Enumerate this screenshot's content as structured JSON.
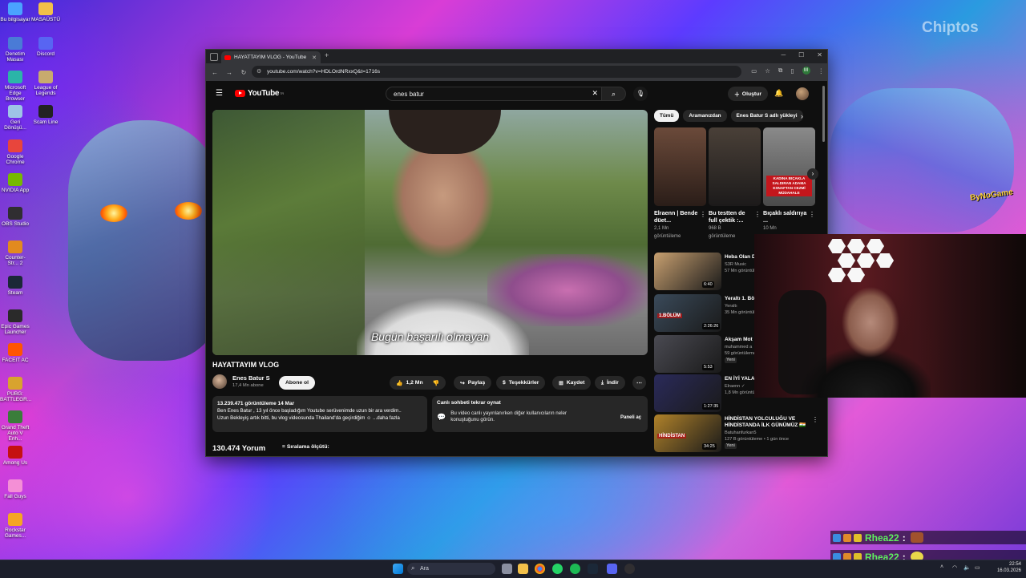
{
  "desktop": {
    "watermark": "Chiptos",
    "bynogame": "ByNoGame",
    "icons": [
      {
        "label": "Bu bilgisayar",
        "icon": "computer-icon",
        "color": "#4aa3ff"
      },
      {
        "label": "MASAÜSTÜ",
        "icon": "folder-icon",
        "color": "#f2c04a"
      },
      {
        "label": "Denetim Masası",
        "icon": "control-panel-icon",
        "color": "#4a7bd6"
      },
      {
        "label": "Discord",
        "icon": "discord-icon",
        "color": "#5865f2"
      },
      {
        "label": "Microsoft Edge Browser",
        "icon": "edge-icon",
        "color": "#2bb5a8"
      },
      {
        "label": "League of Legends",
        "icon": "lol-icon",
        "color": "#c8aa6e"
      },
      {
        "label": "Geri Dönüşü...",
        "icon": "recycle-bin-icon",
        "color": "#9ec4e6"
      },
      {
        "label": "Scam Line",
        "icon": "game-icon",
        "color": "#222222"
      },
      {
        "label": "Google Chrome",
        "icon": "chrome-icon",
        "color": "#e8453c"
      },
      {
        "label": "NVIDIA App",
        "icon": "nvidia-icon",
        "color": "#76b900"
      },
      {
        "label": "OBS Studio",
        "icon": "obs-icon",
        "color": "#302e31"
      },
      {
        "label": "Counter-Str... 2",
        "icon": "cs2-icon",
        "color": "#e28a1e"
      },
      {
        "label": "Steam",
        "icon": "steam-icon",
        "color": "#1b2838"
      },
      {
        "label": "Epic Games Launcher",
        "icon": "epic-icon",
        "color": "#2a2a2a"
      },
      {
        "label": "FACEIT AC",
        "icon": "faceit-icon",
        "color": "#ff5500"
      },
      {
        "label": "PUBG: BATTLEGR...",
        "icon": "pubg-icon",
        "color": "#d8a32e"
      },
      {
        "label": "Grand Theft Auto V Enh...",
        "icon": "gta-icon",
        "color": "#3a7d3a"
      },
      {
        "label": "Among Us",
        "icon": "among-us-icon",
        "color": "#c51111"
      },
      {
        "label": "Fall Guys",
        "icon": "fall-guys-icon",
        "color": "#f48fd6"
      },
      {
        "label": "Rockstar Games...",
        "icon": "rockstar-icon",
        "color": "#f5a623"
      }
    ]
  },
  "browser": {
    "tab_title": "HAYATTAYIM VLOG - YouTube",
    "url": "youtube.com/watch?v=HDLOrdNRxxQ&t=1716s",
    "profile_letter": "M"
  },
  "youtube": {
    "logo": "YouTube",
    "logo_region": "TR",
    "search_value": "enes batur",
    "create_label": "Oluştur",
    "subtitle": "Bugün başarılı olmayan",
    "video_title": "HAYATTAYIM VLOG",
    "channel_name": "Enes Batur S",
    "channel_subs": "17,4 Mn abone",
    "subscribe_label": "Abone ol",
    "like_count": "1,2 Mn",
    "share_label": "Paylaş",
    "thanks_label": "Teşekkürler",
    "save_label": "Kaydet",
    "download_label": "İndir",
    "desc_meta": "13.239.471 görüntüleme  14 Mar",
    "desc_line1": "Ben Enes Batur , 13 yıl önce başladığım Youtube serüvenimde uzun bir ara verdim..",
    "desc_line2": "Uzun Bekleyiş artık bitti, bu vlog videosunda Thailand'da geçirdiğim ☺ ...daha fazla",
    "chat_title": "Canlı sohbeti tekrar oynat",
    "chat_text": "Bu video canlı yayınlanırken diğer kullanıcıların neler konuştuğunu görün.",
    "chat_button": "Paneli aç",
    "comment_count": "130.474 Yorum",
    "sort_label": "Sıralama ölçütü:",
    "chips": [
      "Tümü",
      "Aramanızdan",
      "Enes Batur S adlı yükleyi"
    ],
    "shorts": [
      {
        "title": "Elraenn | Bende düet...",
        "meta1": "2,1 Mn",
        "meta2": "görüntüleme",
        "color": "#5a3a2a"
      },
      {
        "title": "Bu testten de full çektik :...",
        "meta1": "968 B",
        "meta2": "görüntüleme",
        "color": "#3a3a3a"
      },
      {
        "title": "Bıçaklı saldırıya ...",
        "meta1": "10 Mn",
        "meta2": "",
        "caption": "KADINA BIÇAKLA SALDIRAN ADAMA ESNAFTAN CEZMİ MÜDAHALE",
        "color": "#7a7a7a"
      }
    ],
    "videos": [
      {
        "title": "Heba Olan D",
        "meta1": "S3R Music",
        "meta2": "57 Mn görüntülem",
        "duration": "6:40",
        "color": "#c8a070"
      },
      {
        "title": "Yeraltı 1. Bö",
        "meta1": "Yeraltı",
        "meta2": "35 Mn görüntüle",
        "duration": "2:26:26",
        "overlay": "1.BÖLÜM",
        "color": "#3a4a5a"
      },
      {
        "title": "Akşam Mot",
        "meta1": "muhammed a",
        "meta2": "59 görüntüleme",
        "badge": "Yeni",
        "duration": "5:53",
        "color": "#4a4a52"
      },
      {
        "title": "EN İYİ YALA OYUNU KAZ",
        "meta1": "Elraenn ✓",
        "meta2": "1,8 Mn görüntüleme • 1 ay önce",
        "duration": "1:27:35",
        "color": "#2a2a5a"
      },
      {
        "title": "HİNDİSTAN YOLCULUĞU VE HİNDİSTANDA İLK GÜNÜMÜZ 🇮🇳",
        "meta1": "Batuhanfurkan5",
        "meta2": "127 B görüntüleme • 1 gün önce",
        "badge": "Yeni",
        "duration": "34:25",
        "overlay": "HİNDİSTAN",
        "color": "#b0822a"
      }
    ]
  },
  "chat_overlay": [
    {
      "user": "Rhea22",
      "sep": ":"
    },
    {
      "user": "Rhea22",
      "sep": ":"
    }
  ],
  "taskbar": {
    "search_placeholder": "Ara",
    "time": "22:54",
    "date": "16.03.2026"
  }
}
